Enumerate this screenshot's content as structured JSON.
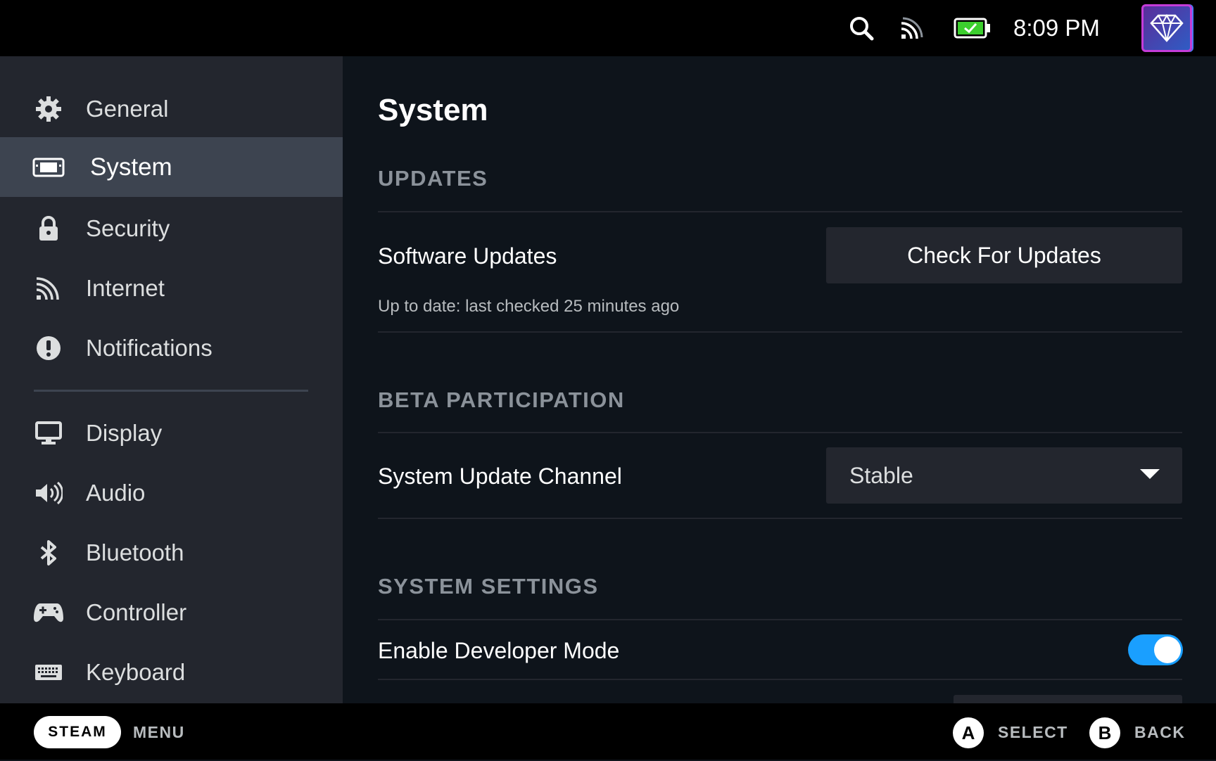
{
  "status_bar": {
    "time": "8:09 PM",
    "icons": [
      "search-icon",
      "cast-icon",
      "battery-charging-icon",
      "avatar-diamond-icon"
    ],
    "battery_color": "#3ccf2e"
  },
  "sidebar": {
    "items": [
      {
        "label": "General",
        "icon": "gear-icon"
      },
      {
        "label": "System",
        "icon": "system-device-icon",
        "active": true
      },
      {
        "label": "Security",
        "icon": "lock-icon"
      },
      {
        "label": "Internet",
        "icon": "wifi-signal-icon"
      },
      {
        "label": "Notifications",
        "icon": "exclamation-icon"
      },
      {
        "label": "Display",
        "icon": "monitor-icon"
      },
      {
        "label": "Audio",
        "icon": "speaker-icon"
      },
      {
        "label": "Bluetooth",
        "icon": "bluetooth-icon"
      },
      {
        "label": "Controller",
        "icon": "gamepad-icon"
      },
      {
        "label": "Keyboard",
        "icon": "keyboard-icon"
      }
    ]
  },
  "main": {
    "title": "System",
    "updates": {
      "heading": "UPDATES",
      "software_updates_label": "Software Updates",
      "check_button": "Check For Updates",
      "status": "Up to date: last checked 25 minutes ago"
    },
    "beta": {
      "heading": "BETA PARTICIPATION",
      "channel_label": "System Update Channel",
      "channel_value": "Stable"
    },
    "system_settings": {
      "heading": "SYSTEM SETTINGS",
      "dev_mode_label": "Enable Developer Mode",
      "dev_mode_enabled": true
    }
  },
  "footer": {
    "steam_label": "STEAM",
    "menu_label": "MENU",
    "a_glyph": "A",
    "select_label": "SELECT",
    "b_glyph": "B",
    "back_label": "BACK"
  },
  "colors": {
    "accent": "#1a9fff",
    "sidebar_bg": "#23262e",
    "active_bg": "#3d4450",
    "main_bg": "#0e141b"
  }
}
